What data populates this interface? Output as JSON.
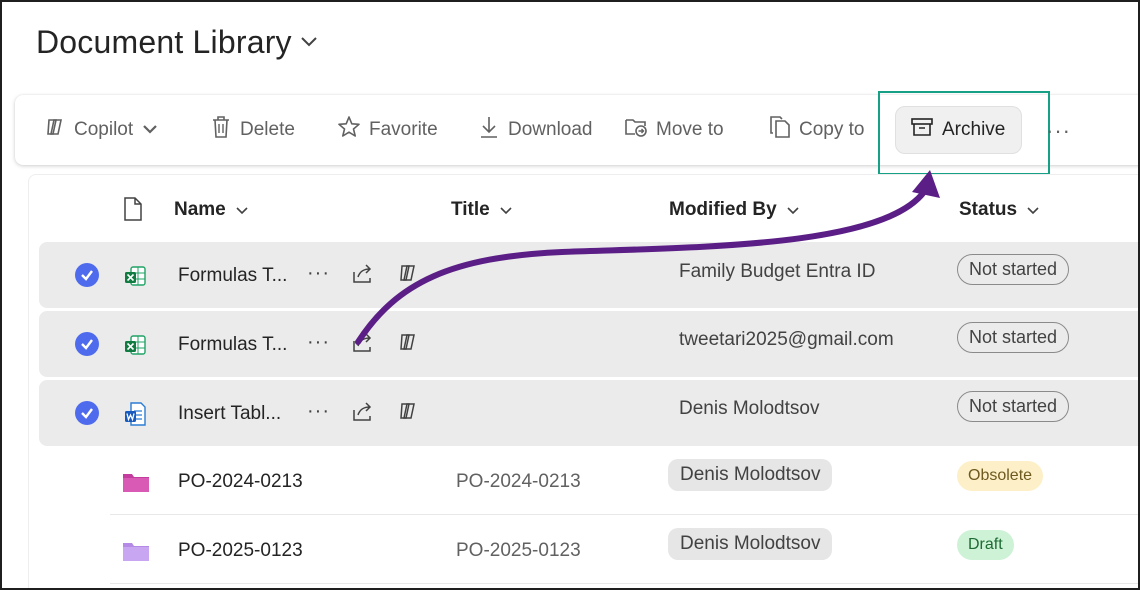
{
  "page": {
    "title": "Document Library"
  },
  "commandbar": {
    "copilot": "Copilot",
    "delete": "Delete",
    "favorite": "Favorite",
    "download": "Download",
    "move_to": "Move to",
    "copy_to": "Copy to",
    "archive": "Archive",
    "more": "···"
  },
  "columns": {
    "name": "Name",
    "title": "Title",
    "modified_by": "Modified By",
    "status": "Status"
  },
  "rows": [
    {
      "selected": true,
      "type": "excel",
      "name": "Formulas T...",
      "title": "",
      "modified_by": "Family Budget Entra ID",
      "status": "Not started"
    },
    {
      "selected": true,
      "type": "excel",
      "name": "Formulas T...",
      "title": "",
      "modified_by": "tweetari2025@gmail.com",
      "status": "Not started"
    },
    {
      "selected": true,
      "type": "word",
      "name": "Insert Tabl...",
      "title": "",
      "modified_by": "Denis Molodtsov",
      "status": "Not started"
    },
    {
      "selected": false,
      "type": "folder-pink",
      "name": "PO-2024-0213",
      "title": "PO-2024-0213",
      "modified_by": "Denis Molodtsov",
      "status": "Obsolete"
    },
    {
      "selected": false,
      "type": "folder-lilac",
      "name": "PO-2025-0123",
      "title": "PO-2025-0123",
      "modified_by": "Denis Molodtsov",
      "status": "Draft"
    }
  ],
  "row_actions": {
    "more": "···"
  },
  "colors": {
    "highlight_box": "#16a085",
    "arrow": "#5b1e86",
    "check": "#4f6bed",
    "obsolete_bg": "#fdf0c8",
    "draft_bg": "#cdf2d6"
  },
  "icons": [
    "copilot-icon",
    "trash-icon",
    "star-icon",
    "download-icon",
    "move-to-icon",
    "copy-icon",
    "archive-icon",
    "document-icon",
    "share-icon",
    "excel-icon",
    "word-icon",
    "folder-icon",
    "chevron-down-icon",
    "checkmark-icon"
  ]
}
